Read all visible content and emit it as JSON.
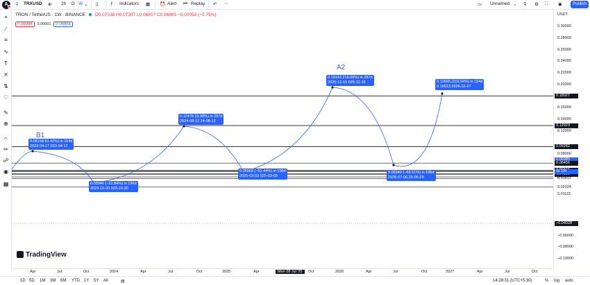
{
  "topbar": {
    "symbol": "TRXUSD",
    "interval": "2h",
    "d": "D",
    "w": "W",
    "indicators": "Indicators",
    "alert": "Alert",
    "replay": "Replay",
    "layout": "Unnamed",
    "publish": "Publish"
  },
  "legend": {
    "title": "TRON / TetherUS · 1W · BINANCE",
    "ohlc": "O0.07038 H0.07307 L0.06807 C0.06985 −0.00053 (−0.75%)",
    "bid": "0.06984",
    "spread": "0.00001",
    "ask": "0.06985"
  },
  "axis": {
    "currency": "USDT",
    "ticks": [
      {
        "v": 0.3,
        "t": "0.30000"
      },
      {
        "v": 0.28,
        "t": "0.28000"
      },
      {
        "v": 0.26,
        "t": "0.26000"
      },
      {
        "v": 0.24,
        "t": "0.24000"
      },
      {
        "v": 0.22,
        "t": "0.22000"
      },
      {
        "v": 0.2,
        "t": "0.20000"
      },
      {
        "v": 0.16,
        "t": "0.16000"
      },
      {
        "v": 0.14,
        "t": "0.14000"
      },
      {
        "v": 0.12,
        "t": "0.12000"
      },
      {
        "v": 0.08,
        "t": "0.08000"
      },
      {
        "v": 0.04079,
        "t": "0.04079"
      },
      {
        "v": 0.03812,
        "t": "0.03812"
      },
      {
        "v": 0.02324,
        "t": "0.02324"
      },
      {
        "v": 0.01115,
        "t": "0.01115"
      },
      {
        "v": -0.06,
        "t": "−0.06000"
      },
      {
        "v": -0.08,
        "t": "−0.08000"
      },
      {
        "v": -0.1,
        "t": "−0.10000"
      }
    ],
    "tags": [
      {
        "v": 0.18027,
        "t": "0.18027",
        "bg": "#131722"
      },
      {
        "v": 0.12923,
        "t": "0.12923",
        "bg": "#131722"
      },
      {
        "v": 0.09282,
        "t": "0.09282",
        "bg": "#131722"
      },
      {
        "v": 0.06985,
        "t": "0.06985",
        "bg": "#2962ff"
      },
      {
        "v": 0.06456,
        "t": "0.06456",
        "bg": "#131722"
      },
      {
        "v": 0.05218,
        "t": "0.05218",
        "bg": "#131722"
      },
      {
        "v": 0.05116,
        "t": "0.05116",
        "bg": "#131722"
      },
      {
        "v": 0.04998,
        "t": "0.04998",
        "bg": "#131722"
      },
      {
        "v": 0.04633,
        "t": "0.04633",
        "bg": "#131722"
      },
      {
        "v": 0.04519,
        "t": "0.04519",
        "bg": "#131722"
      },
      {
        "v": -0.04028,
        "t": "−0.04028",
        "bg": "#131722"
      }
    ]
  },
  "hlines": [
    0.18027,
    0.12923,
    0.09282,
    0.06456,
    0.05218,
    0.05116,
    0.04998,
    0.04633,
    0.04519,
    0.04079,
    0.03812,
    0.02324
  ],
  "waves": [
    {
      "id": "B1",
      "label": "B1"
    },
    {
      "id": "A2",
      "label": "A2"
    }
  ],
  "boxes": [
    {
      "id": "b1",
      "l1": "0.08198    81.42%) in 154d",
      "l2": "2023-04-17    023-04-17"
    },
    {
      "id": "b2",
      "l1": "0.03946    (−51.84%) in 196d",
      "l2": "2023-10-30    023-10-30"
    },
    {
      "id": "b3",
      "l1": "0.12476    15.98%) in 287d",
      "l2": "2024-08-12    24-08-12"
    },
    {
      "id": "b4",
      "l1": "0.06069    (−51.44%) in 196d",
      "l2": "2025-03-03    025-03-03"
    },
    {
      "id": "b5",
      "l1": "0.19143    216.06%) in 287d",
      "l2": "2025-12-15    025-12-15"
    },
    {
      "id": "b6",
      "l1": "0.06849    (−69.51%) in 196d",
      "l2": "2026-07-06    26-06-29"
    },
    {
      "id": "b7",
      "l1": "0.12665 (216.54%) in 154d",
      "l2": "0.18013 2026-12-27"
    }
  ],
  "timeaxis": {
    "labels": [
      "Apr",
      "Jul",
      "Oct",
      "2024",
      "Apr",
      "Jul",
      "Oct",
      "2025",
      "Apr",
      "Mon 28 Jul '25",
      "Oct",
      "2026",
      "Apr",
      "Jul",
      "Oct",
      "2027",
      "Apr",
      "Jul",
      "Oct"
    ]
  },
  "bottom": {
    "ranges": [
      "1D",
      "5D",
      "1M",
      "3M",
      "6M",
      "YTD",
      "1Y",
      "5Y",
      "All"
    ],
    "clock": "14:28:31 (UTC+5:30)",
    "percent": "%",
    "log": "log",
    "auto": "auto"
  },
  "brand": "TradingView",
  "countdown": "4d 19h"
}
